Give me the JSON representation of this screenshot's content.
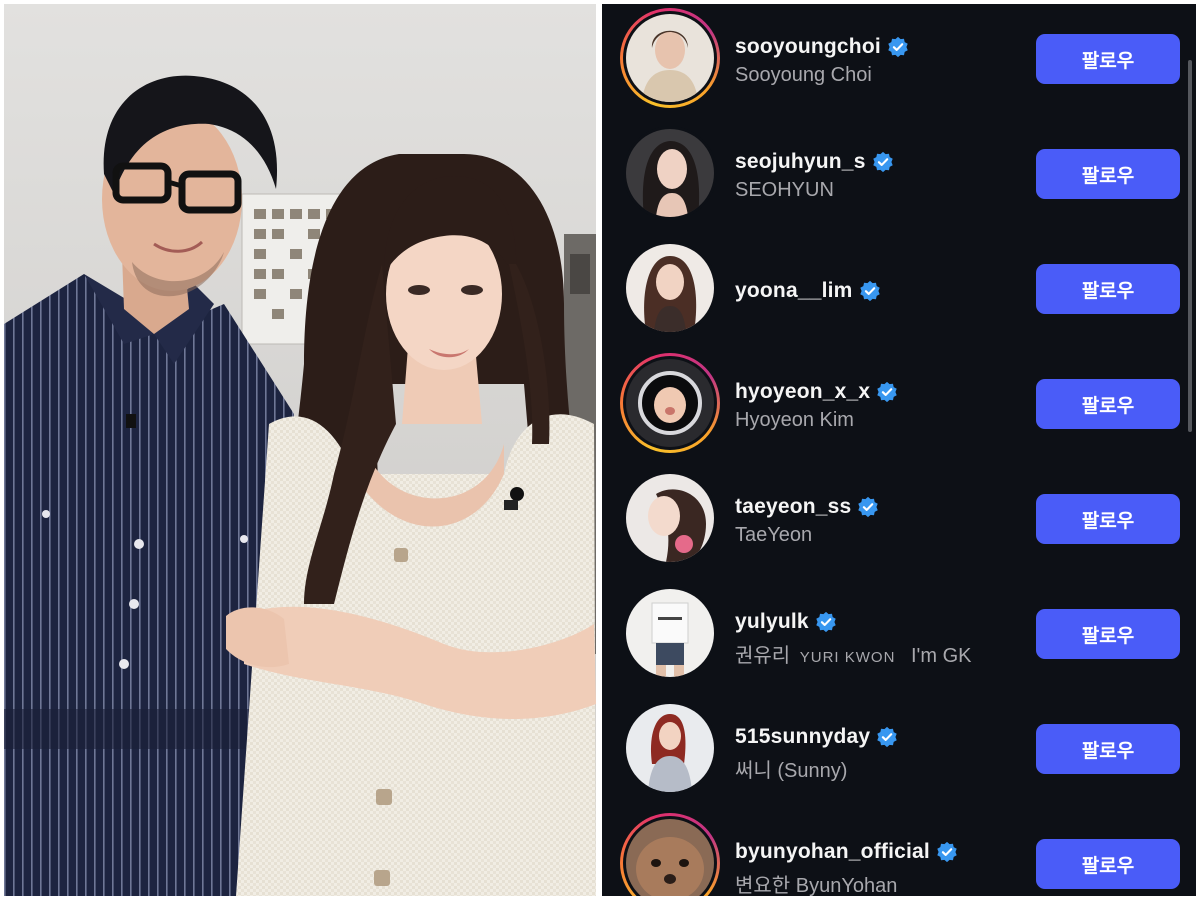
{
  "follow_list": {
    "button_label": "팔로우",
    "accent_color": "#4a5cf8",
    "verified_color": "#3897f0",
    "story_ring_colors": [
      "#f9c12a",
      "#e1306c",
      "#c13584"
    ],
    "accounts": [
      {
        "username": "sooyoungchoi",
        "full_name": "Sooyoung Choi",
        "story_ring": true,
        "verified": true
      },
      {
        "username": "seojuhyun_s",
        "full_name": "SEOHYUN",
        "story_ring": false,
        "verified": true
      },
      {
        "username": "yoona__lim",
        "full_name": "",
        "story_ring": false,
        "verified": true
      },
      {
        "username": "hyoyeon_x_x",
        "full_name": "Hyoyeon Kim",
        "story_ring": true,
        "verified": true
      },
      {
        "username": "taeyeon_ss",
        "full_name": "TaeYeon",
        "story_ring": false,
        "verified": true
      },
      {
        "username": "yulyulk",
        "full_name_parts": [
          "권유리",
          "YURI KWON",
          "I'm GK"
        ],
        "story_ring": false,
        "verified": true
      },
      {
        "username": "515sunnyday",
        "full_name": "써니 (Sunny)",
        "story_ring": false,
        "verified": true
      },
      {
        "username": "byunyohan_official",
        "full_name": "변요한 ByunYohan",
        "story_ring": true,
        "verified": true
      }
    ]
  }
}
